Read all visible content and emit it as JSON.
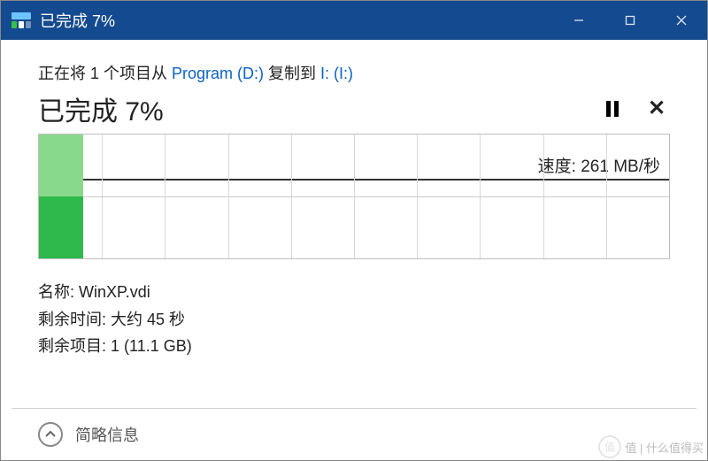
{
  "window": {
    "title": "已完成 7%"
  },
  "copy": {
    "prefix": "正在将 1 个项目从 ",
    "source": "Program (D:)",
    "mid": " 复制到 ",
    "dest": "I: (I:)"
  },
  "progress": {
    "heading": "已完成 7%",
    "percent": 7
  },
  "graph": {
    "speed_label_prefix": "速度: ",
    "speed_value": "261 MB/秒",
    "columns": 10
  },
  "details": {
    "name_label": "名称: ",
    "name_value": "WinXP.vdi",
    "time_label": "剩余时间: ",
    "time_value": "大约 45 秒",
    "items_label": "剩余项目: ",
    "items_value": "1 (11.1 GB)"
  },
  "footer": {
    "label": "简略信息"
  },
  "watermark": {
    "text": "值 | 什么值得买"
  }
}
